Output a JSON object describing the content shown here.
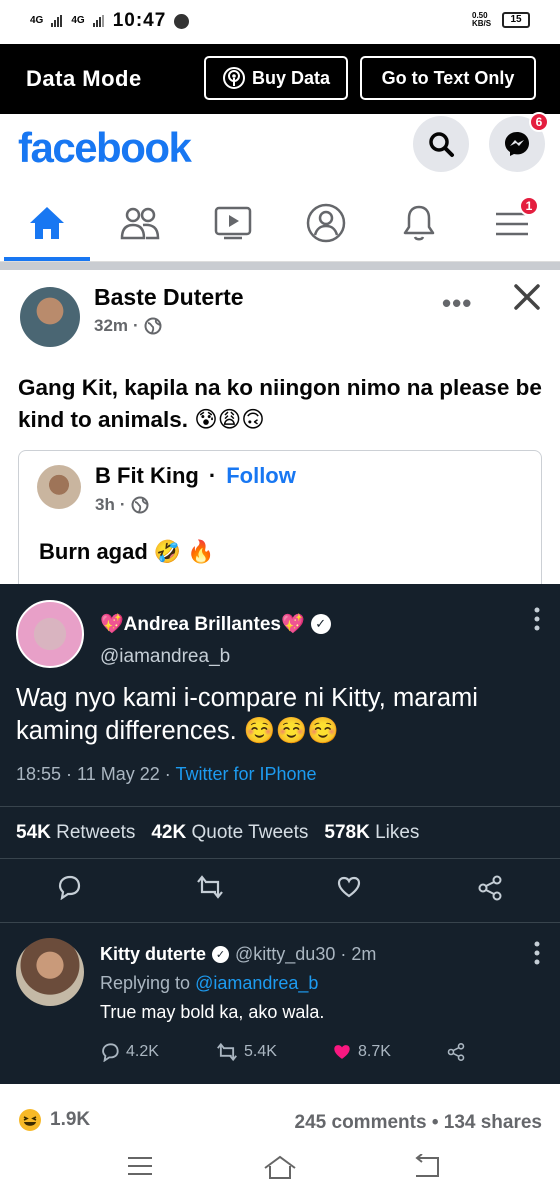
{
  "status_bar": {
    "signal1": "4G",
    "signal2": "4G",
    "time": "10:47",
    "net_speed": "0.50 KB/S",
    "battery": "15"
  },
  "data_mode": {
    "title": "Data Mode",
    "buy_data_label": "Buy Data",
    "text_only_label": "Go to Text Only"
  },
  "header": {
    "logo": "facebook",
    "messenger_badge": "6"
  },
  "nav": {
    "menu_badge": "1",
    "active_tab": "home"
  },
  "post": {
    "author": "Baste Duterte",
    "time": "32m",
    "more_label": "•••",
    "text": "Gang Kit, kapila na ko niingon nimo na please be kind to animals. 😰😩🙃",
    "shared": {
      "author": "B Fit King",
      "separator": "·",
      "follow_label": "Follow",
      "time": "3h",
      "text": "Burn agad 🤣 🔥"
    }
  },
  "tweet": {
    "name": "💖Andrea Brillantes💖",
    "handle": "@iamandrea_b",
    "body": "Wag nyo kami i-compare ni Kitty, marami kaming differences. ☺️☺️☺️",
    "timestamp": "18:55 · 11 May 22 · ",
    "source": "Twitter for IPhone",
    "retweets_count": "54K",
    "retweets_label": "Retweets",
    "quotes_count": "42K",
    "quotes_label": "Quote Tweets",
    "likes_count": "578K",
    "likes_label": "Likes"
  },
  "reply": {
    "name": "Kitty duterte",
    "handle_time": "@kitty_du30 · 2m",
    "replying_prefix": "Replying to ",
    "replying_handle": "@iamandrea_b",
    "text": "True may bold ka, ako wala.",
    "replies": "4.2K",
    "retweets": "5.4K",
    "likes": "8.7K"
  },
  "footer": {
    "reaction_count": "1.9K",
    "comments_shares": "245 comments • 134 shares"
  }
}
